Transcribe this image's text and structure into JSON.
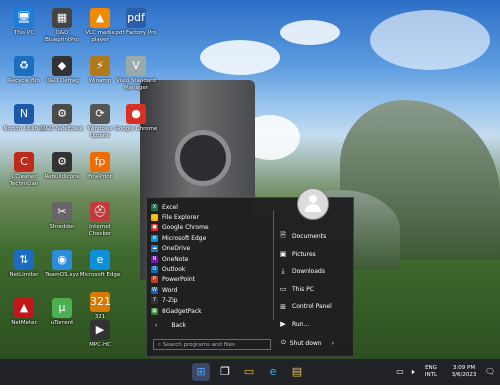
{
  "desktop": {
    "icons": [
      {
        "label": "This PC",
        "glyph": "🖥",
        "color": "#1f7bd8"
      },
      {
        "label": "O&O BlueprintPro",
        "glyph": "▦",
        "color": "#444"
      },
      {
        "label": "VLC media player",
        "glyph": "▲",
        "color": "#f08a00"
      },
      {
        "label": "pdf Factory Pro",
        "glyph": "pdf",
        "color": "#2a5fa8"
      },
      {
        "label": "Recycle Bin",
        "glyph": "♻",
        "color": "#1c6fbf"
      },
      {
        "label": "O&O Defrag",
        "glyph": "◆",
        "color": "#333"
      },
      {
        "label": "Winamp",
        "glyph": "⚡",
        "color": "#b07a1a"
      },
      {
        "label": "Visio Standard Manager",
        "glyph": "V",
        "color": "#9aa"
      },
      {
        "label": "Norton Utilities",
        "glyph": "N",
        "color": "#1b5aa8"
      },
      {
        "label": "O&O SafeErase",
        "glyph": "⚙",
        "color": "#4a4a4a"
      },
      {
        "label": "Windows Update",
        "glyph": "⟳",
        "color": "#555"
      },
      {
        "label": "Google Chrome",
        "glyph": "●",
        "color": "#d93025"
      },
      {
        "label": "CCleaner Technician",
        "glyph": "C",
        "color": "#c02a1a"
      },
      {
        "label": "RebuildIcons",
        "glyph": "⚙",
        "color": "#333"
      },
      {
        "label": "FinePrint",
        "glyph": "fp",
        "color": "#ef6c00"
      },
      {
        "label": "Shredder",
        "glyph": "✂",
        "color": "#666"
      },
      {
        "label": "Internet Checker",
        "glyph": "⛑",
        "color": "#c23b3b"
      },
      {
        "label": "NetLimiter",
        "glyph": "⇅",
        "color": "#1b6bc0"
      },
      {
        "label": "TeamOS.xyz",
        "glyph": "◉",
        "color": "#2b8cd9"
      },
      {
        "label": "Microsoft Edge",
        "glyph": "e",
        "color": "#0b8fd9"
      },
      {
        "label": "321",
        "glyph": "321",
        "color": "#d97a00"
      },
      {
        "label": "NetMeter",
        "glyph": "▲",
        "color": "#c01818"
      },
      {
        "label": "uTorrent",
        "glyph": "µ",
        "color": "#4caf50"
      },
      {
        "label": "MPC-HC",
        "glyph": "▶",
        "color": "#333"
      }
    ]
  },
  "start_menu": {
    "apps": [
      {
        "label": "Excel",
        "glyph": "X",
        "color": "#1d7044"
      },
      {
        "label": "File Explorer",
        "glyph": "▭",
        "color": "#f2b700"
      },
      {
        "label": "Google Chrome",
        "glyph": "●",
        "color": "#d93025"
      },
      {
        "label": "Microsoft Edge",
        "glyph": "e",
        "color": "#0b8fd9"
      },
      {
        "label": "OneDrive",
        "glyph": "☁",
        "color": "#1b78d0"
      },
      {
        "label": "OneNote",
        "glyph": "N",
        "color": "#7719aa"
      },
      {
        "label": "Outlook",
        "glyph": "O",
        "color": "#0f6cbd"
      },
      {
        "label": "PowerPoint",
        "glyph": "P",
        "color": "#c43e1c"
      },
      {
        "label": "Word",
        "glyph": "W",
        "color": "#1b5eb5"
      },
      {
        "label": "7-Zip",
        "glyph": "7",
        "color": "#333"
      },
      {
        "label": "8GadgetPack",
        "glyph": "▦",
        "color": "#2e7d32"
      }
    ],
    "back_label": "Back",
    "search_placeholder": "Search programs and files",
    "right_items": [
      {
        "label": "Documents",
        "glyph": "🗎"
      },
      {
        "label": "Pictures",
        "glyph": "▣"
      },
      {
        "label": "Downloads",
        "glyph": "⤓"
      },
      {
        "label": "This PC",
        "glyph": "▭"
      },
      {
        "label": "Control Panel",
        "glyph": "⊞"
      },
      {
        "label": "Run...",
        "glyph": "▶"
      }
    ],
    "shutdown_label": "Shut down"
  },
  "taskbar": {
    "language": "ENG",
    "layout": "INTL",
    "time": "3:09 PM",
    "date": "3/6/2023"
  }
}
